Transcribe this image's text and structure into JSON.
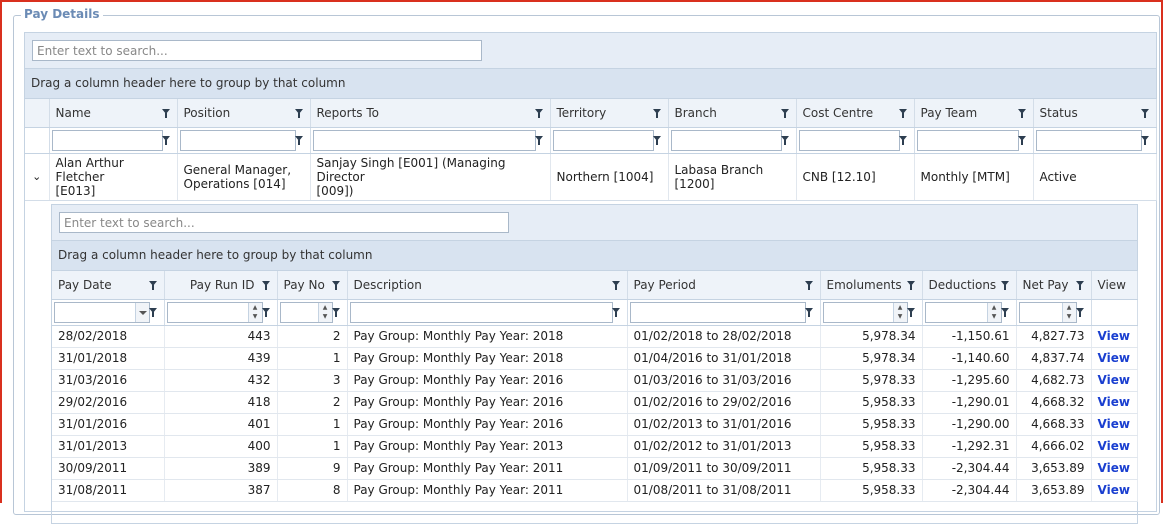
{
  "panel": {
    "legend": "Pay Details"
  },
  "outer_grid": {
    "search_placeholder": "Enter text to search...",
    "group_hint": "Drag a column header here to group by that column",
    "columns": [
      "Name",
      "Position",
      "Reports To",
      "Territory",
      "Branch",
      "Cost Centre",
      "Pay Team",
      "Status"
    ],
    "row": {
      "name_line1": "Alan Arthur Fletcher",
      "name_line2": "[E013]",
      "position_line1": "General Manager,",
      "position_line2": "Operations [014]",
      "reports_line1": "Sanjay Singh [E001] (Managing Director",
      "reports_line2": "[009])",
      "territory": "Northern [1004]",
      "branch_line1": "Labasa Branch",
      "branch_line2": "[1200]",
      "cost_centre": "CNB [12.10]",
      "pay_team": "Monthly [MTM]",
      "status": "Active"
    }
  },
  "inner_grid": {
    "search_placeholder": "Enter text to search...",
    "group_hint": "Drag a column header here to group by that column",
    "columns": [
      "Pay Date",
      "Pay Run ID",
      "Pay No",
      "Description",
      "Pay Period",
      "Emoluments",
      "Deductions",
      "Net Pay",
      "View"
    ],
    "rows": [
      {
        "pay_date": "28/02/2018",
        "run_id": "443",
        "pay_no": "2",
        "description": "Pay Group: Monthly Pay Year: 2018",
        "period": "01/02/2018 to 28/02/2018",
        "emoluments": "5,978.34",
        "deductions": "-1,150.61",
        "net_pay": "4,827.73",
        "view": "View"
      },
      {
        "pay_date": "31/01/2018",
        "run_id": "439",
        "pay_no": "1",
        "description": "Pay Group: Monthly Pay Year: 2018",
        "period": "01/04/2016 to 31/01/2018",
        "emoluments": "5,978.34",
        "deductions": "-1,140.60",
        "net_pay": "4,837.74",
        "view": "View"
      },
      {
        "pay_date": "31/03/2016",
        "run_id": "432",
        "pay_no": "3",
        "description": "Pay Group: Monthly Pay Year: 2016",
        "period": "01/03/2016 to 31/03/2016",
        "emoluments": "5,978.33",
        "deductions": "-1,295.60",
        "net_pay": "4,682.73",
        "view": "View"
      },
      {
        "pay_date": "29/02/2016",
        "run_id": "418",
        "pay_no": "2",
        "description": "Pay Group: Monthly Pay Year: 2016",
        "period": "01/02/2016 to 29/02/2016",
        "emoluments": "5,958.33",
        "deductions": "-1,290.01",
        "net_pay": "4,668.32",
        "view": "View"
      },
      {
        "pay_date": "31/01/2016",
        "run_id": "401",
        "pay_no": "1",
        "description": "Pay Group: Monthly Pay Year: 2016",
        "period": "01/02/2013 to 31/01/2016",
        "emoluments": "5,958.33",
        "deductions": "-1,290.00",
        "net_pay": "4,668.33",
        "view": "View"
      },
      {
        "pay_date": "31/01/2013",
        "run_id": "400",
        "pay_no": "1",
        "description": "Pay Group: Monthly Pay Year: 2013",
        "period": "01/02/2012 to 31/01/2013",
        "emoluments": "5,958.33",
        "deductions": "-1,292.31",
        "net_pay": "4,666.02",
        "view": "View"
      },
      {
        "pay_date": "30/09/2011",
        "run_id": "389",
        "pay_no": "9",
        "description": "Pay Group: Monthly Pay Year: 2011",
        "period": "01/09/2011 to 30/09/2011",
        "emoluments": "5,958.33",
        "deductions": "-2,304.44",
        "net_pay": "3,653.89",
        "view": "View"
      },
      {
        "pay_date": "31/08/2011",
        "run_id": "387",
        "pay_no": "8",
        "description": "Pay Group: Monthly Pay Year: 2011",
        "period": "01/08/2011 to 31/08/2011",
        "emoluments": "5,958.33",
        "deductions": "-2,304.44",
        "net_pay": "3,653.89",
        "view": "View"
      }
    ]
  },
  "icons": {
    "filter": "filter-funnel-icon",
    "expand": "chevron-down-icon"
  }
}
